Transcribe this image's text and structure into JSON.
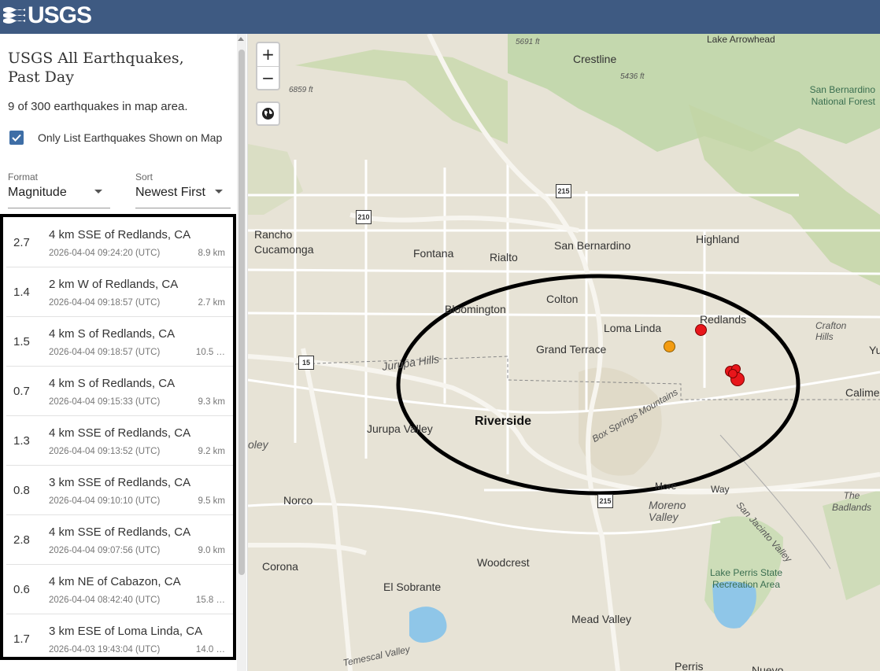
{
  "header": {
    "logo_text": "USGS",
    "colors": {
      "bar": "#3e5a82"
    }
  },
  "sidebar": {
    "title": "USGS All Earthquakes, Past Day",
    "count_text": "9 of 300 earthquakes in map area.",
    "checkbox": {
      "label": "Only List Earthquakes Shown on Map",
      "checked": true
    },
    "format": {
      "label": "Format",
      "value": "Magnitude"
    },
    "sort": {
      "label": "Sort",
      "value": "Newest First"
    }
  },
  "earthquakes": [
    {
      "mag": "2.7",
      "place": "4 km SSE of Redlands, CA",
      "time": "2026-04-04 09:24:20 (UTC)",
      "depth": "8.9 km"
    },
    {
      "mag": "1.4",
      "place": "2 km W of Redlands, CA",
      "time": "2026-04-04 09:18:57 (UTC)",
      "depth": "2.7 km"
    },
    {
      "mag": "1.5",
      "place": "4 km S of Redlands, CA",
      "time": "2026-04-04 09:18:57 (UTC)",
      "depth": "10.5 …"
    },
    {
      "mag": "0.7",
      "place": "4 km S of Redlands, CA",
      "time": "2026-04-04 09:15:33 (UTC)",
      "depth": "9.3 km"
    },
    {
      "mag": "1.3",
      "place": "4 km SSE of Redlands, CA",
      "time": "2026-04-04 09:13:52 (UTC)",
      "depth": "9.2 km"
    },
    {
      "mag": "0.8",
      "place": "3 km SSE of Redlands, CA",
      "time": "2026-04-04 09:10:10 (UTC)",
      "depth": "9.5 km"
    },
    {
      "mag": "2.8",
      "place": "4 km SSE of Redlands, CA",
      "time": "2026-04-04 09:07:56 (UTC)",
      "depth": "9.0 km"
    },
    {
      "mag": "0.6",
      "place": "4 km NE of Cabazon, CA",
      "time": "2026-04-04 08:42:40 (UTC)",
      "depth": "15.8 …"
    },
    {
      "mag": "1.7",
      "place": "3 km ESE of Loma Linda, CA",
      "time": "2026-04-03 19:43:04 (UTC)",
      "depth": "14.0 …"
    }
  ],
  "map": {
    "zoom_in": "+",
    "zoom_out": "−",
    "globe_icon": "globe-icon",
    "places": {
      "lake_arrowhead": "Lake Arrowhead",
      "crestline": "Crestline",
      "san_bernardino_nf": "San Bernardino National Forest",
      "rancho_cucamonga": "Rancho Cucamonga",
      "fontana": "Fontana",
      "rialto": "Rialto",
      "san_bernardino": "San Bernardino",
      "highland": "Highland",
      "colton": "Colton",
      "bloomington": "Bloomington",
      "loma_linda": "Loma Linda",
      "redlands": "Redlands",
      "crafton_hills": "Crafton Hills",
      "grand_terrace": "Grand Terrace",
      "jurupa_hills": "Jurupa Hills",
      "riverside": "Riverside",
      "jurupa_valley": "Jurupa Valley",
      "box_springs": "Box Springs Mountains",
      "calimesa": "Calime",
      "yu": "Yu",
      "norco": "Norco",
      "moreno_valley": "Moreno Valley",
      "san_jacinto_valley": "San Jacinto Valley",
      "the_badlands": "The Badlands",
      "corona": "Corona",
      "woodcrest": "Woodcrest",
      "el_sobrante": "El Sobrante",
      "lake_perris": "Lake Perris State Recreation Area",
      "mead_valley": "Mead Valley",
      "temescal_valley": "Temescal Valley",
      "perris": "Perris",
      "nuevo": "Nuevo",
      "box_valley": "oley",
      "more": "More",
      "way": "Way"
    },
    "elevations": [
      "5691 ft",
      "5436 ft",
      "6859 ft"
    ],
    "shields": [
      "210",
      "215",
      "15",
      "215"
    ],
    "quake_colors": {
      "recent": "#e8161b",
      "older": "#f39c12"
    }
  }
}
